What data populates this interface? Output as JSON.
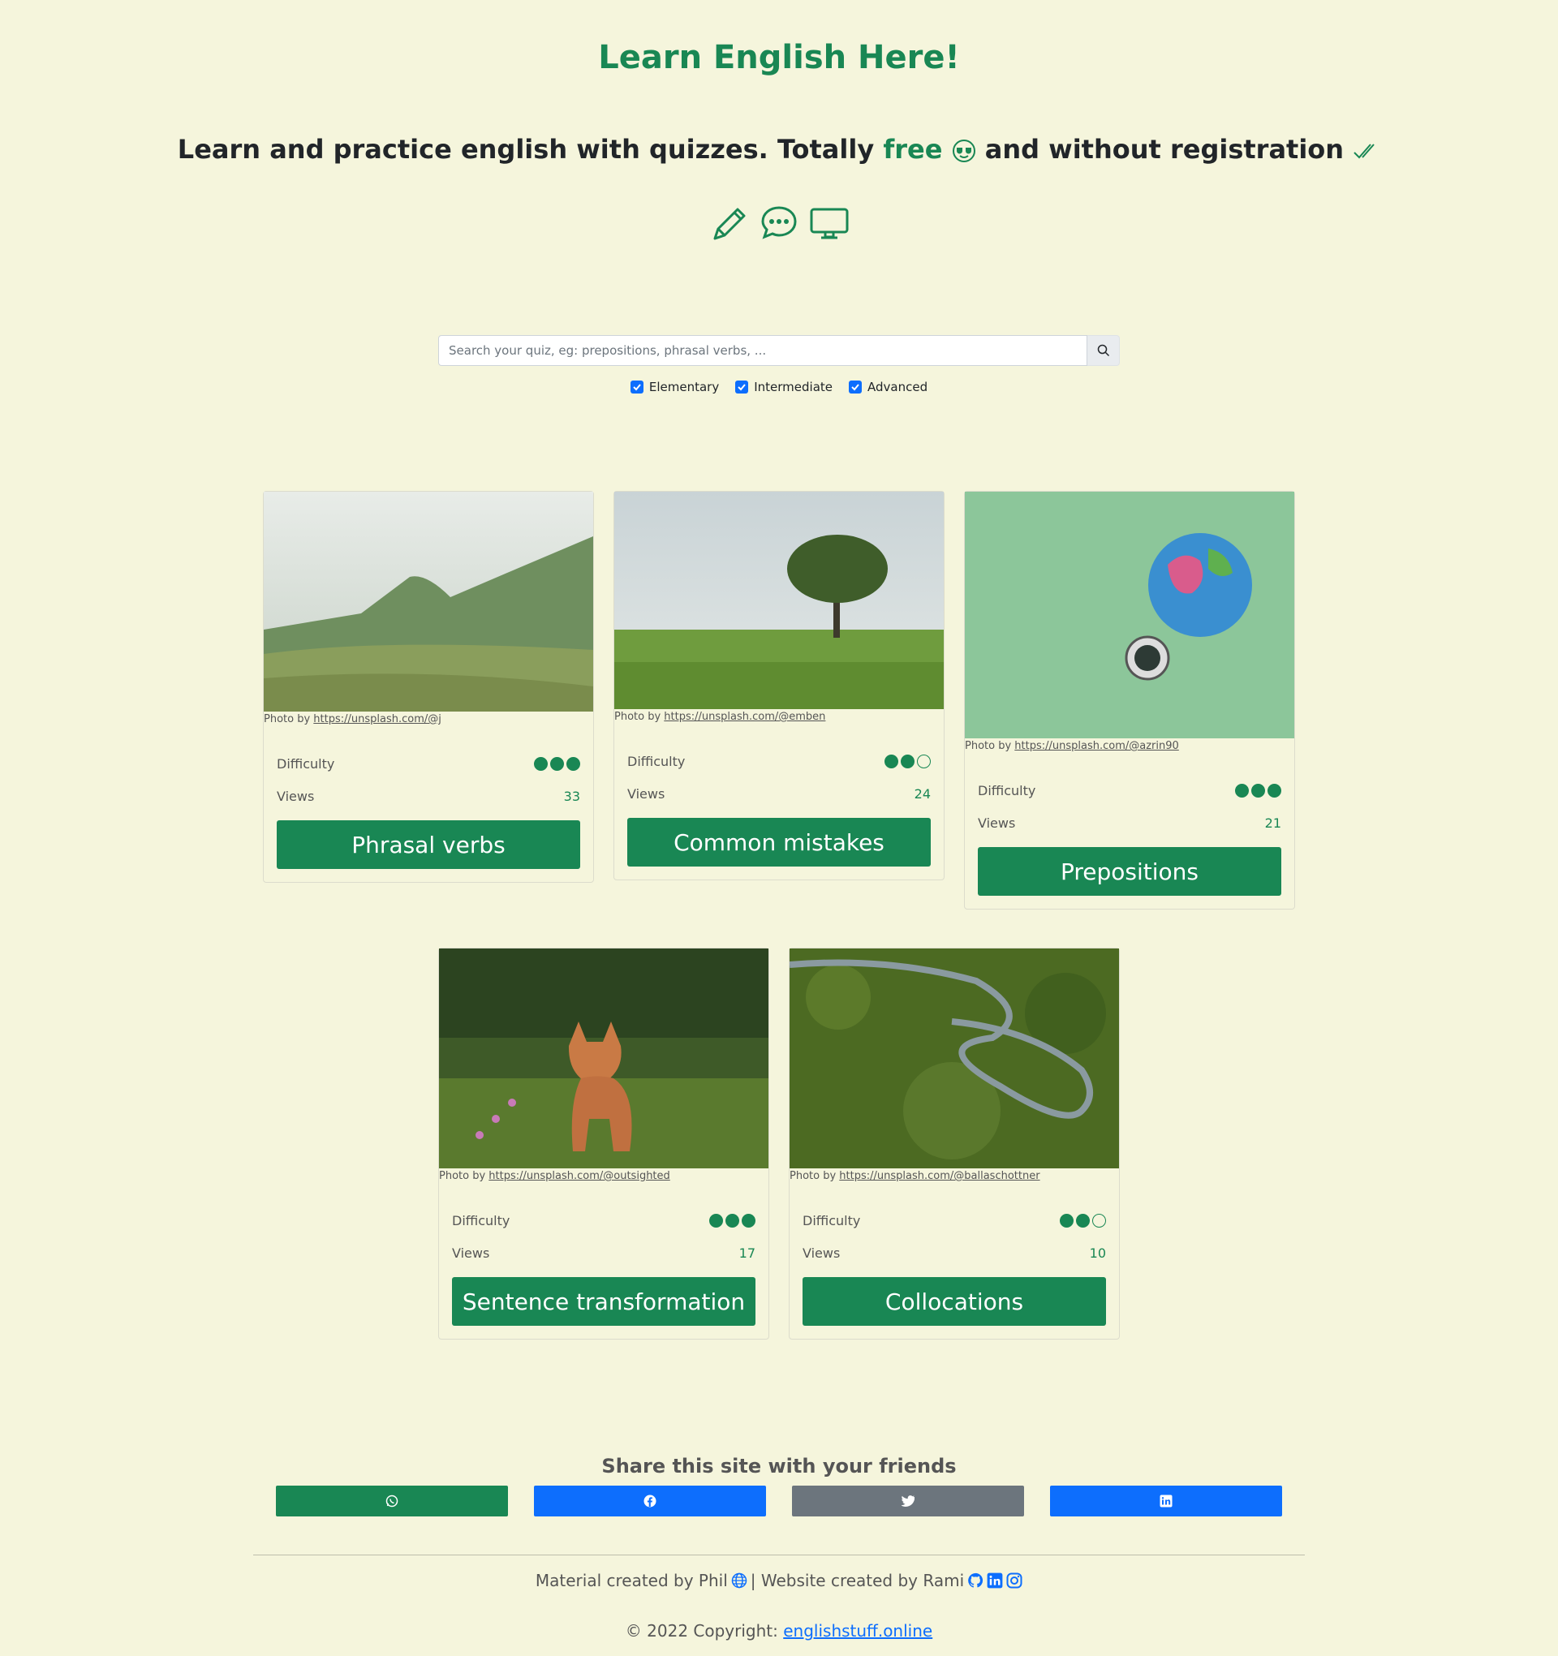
{
  "header": {
    "title": "Learn English Here!",
    "subtitle_pre": "Learn and practice english with quizzes. Totally ",
    "subtitle_free": "free",
    "subtitle_post": " and without registration",
    "icons": [
      "pencil-icon",
      "chat-dots-icon",
      "display-icon"
    ]
  },
  "search": {
    "placeholder": "Search your quiz, eg: prepositions, phrasal verbs, ...",
    "value": ""
  },
  "filters": [
    {
      "label": "Elementary",
      "checked": true
    },
    {
      "label": "Intermediate",
      "checked": true
    },
    {
      "label": "Advanced",
      "checked": true
    }
  ],
  "cards": [
    {
      "credit_prefix": "Photo by ",
      "credit_link": "https://unsplash.com/@j",
      "difficulty_label": "Difficulty",
      "difficulty": 3,
      "views_label": "Views",
      "views": "33",
      "button": "Phrasal verbs"
    },
    {
      "credit_prefix": "Photo by ",
      "credit_link": "https://unsplash.com/@emben",
      "difficulty_label": "Difficulty",
      "difficulty": 2,
      "views_label": "Views",
      "views": "24",
      "button": "Common mistakes"
    },
    {
      "credit_prefix": "Photo by ",
      "credit_link": "https://unsplash.com/@azrin90",
      "difficulty_label": "Difficulty",
      "difficulty": 3,
      "views_label": "Views",
      "views": "21",
      "button": "Prepositions"
    },
    {
      "credit_prefix": "Photo by ",
      "credit_link": "https://unsplash.com/@outsighted",
      "difficulty_label": "Difficulty",
      "difficulty": 3,
      "views_label": "Views",
      "views": "17",
      "button": "Sentence transformation"
    },
    {
      "credit_prefix": "Photo by ",
      "credit_link": "https://unsplash.com/@ballaschottner",
      "difficulty_label": "Difficulty",
      "difficulty": 2,
      "views_label": "Views",
      "views": "10",
      "button": "Collocations"
    }
  ],
  "share": {
    "title": "Share this site with your friends",
    "buttons": [
      {
        "icon": "whatsapp-icon",
        "color": "#198754"
      },
      {
        "icon": "facebook-icon",
        "color": "#0d6efd"
      },
      {
        "icon": "twitter-icon",
        "color": "#6c757d"
      },
      {
        "icon": "linkedin-icon",
        "color": "#0d6efd"
      }
    ]
  },
  "footer": {
    "material": "Material created by Phil",
    "separator": "| Website created by Rami",
    "copyright": "© 2022 Copyright: ",
    "site": "englishstuff.online"
  },
  "colors": {
    "accent": "#198754",
    "background": "#f5f5dc",
    "link": "#0d6efd"
  }
}
